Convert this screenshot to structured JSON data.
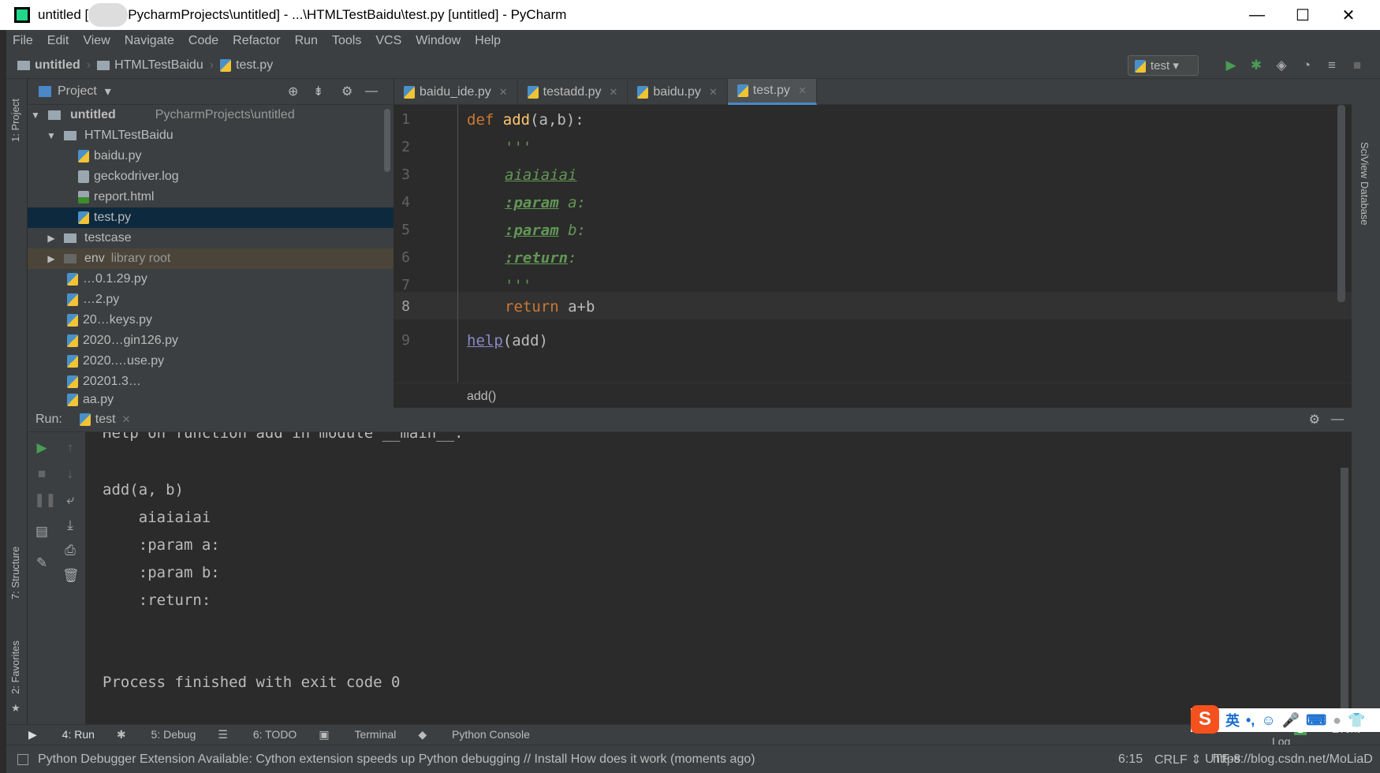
{
  "window": {
    "title_prefix": "untitled [",
    "title_rest": "PycharmProjects\\untitled] - ...\\HTMLTestBaidu\\test.py [untitled] - PyCharm",
    "minimize": "—",
    "maximize": "☐",
    "close": "✕"
  },
  "menu": [
    "File",
    "Edit",
    "View",
    "Navigate",
    "Code",
    "Refactor",
    "Run",
    "Tools",
    "VCS",
    "Window",
    "Help"
  ],
  "breadcrumb": [
    "untitled",
    "HTMLTestBaidu",
    "test.py"
  ],
  "run_config": "test",
  "side_labels": {
    "project": "1: Project",
    "structure": "7: Structure",
    "favorites": "2: Favorites",
    "sciview": "SciView",
    "database": "Database"
  },
  "project": {
    "title": "Project",
    "tree": [
      {
        "label": "untitled",
        "extra": "PycharmProjects\\untitled",
        "type": "folder",
        "open": true
      },
      {
        "label": "HTMLTestBaidu",
        "type": "folder",
        "open": true
      },
      {
        "label": "baidu.py",
        "type": "py"
      },
      {
        "label": "geckodriver.log",
        "type": "log"
      },
      {
        "label": "report.html",
        "type": "html"
      },
      {
        "label": "test.py",
        "type": "py",
        "selected": true
      },
      {
        "label": "testcase",
        "type": "folder",
        "open": false
      },
      {
        "label": "env",
        "extra": "library root",
        "type": "folder",
        "open": false
      },
      {
        "label": "…0.1.29.py",
        "type": "py"
      },
      {
        "label": "…2.py",
        "type": "py"
      },
      {
        "label": "20…keys.py",
        "type": "py"
      },
      {
        "label": "2020…gin126.py",
        "type": "py"
      },
      {
        "label": "2020.…use.py",
        "type": "py"
      },
      {
        "label": "20201.3…",
        "type": "py"
      },
      {
        "label": "aa.py",
        "type": "py"
      }
    ]
  },
  "tabs": [
    {
      "label": "baidu_ide.py"
    },
    {
      "label": "testadd.py"
    },
    {
      "label": "baidu.py"
    },
    {
      "label": "test.py",
      "active": true
    }
  ],
  "code": {
    "l1a": "def",
    "l1b": "add",
    "l1c": "(a,b):",
    "l2": "'''",
    "l3": "aiaiaiai",
    "l4a": ":param",
    "l4b": " a:",
    "l5a": ":param",
    "l5b": " b:",
    "l6a": ":return",
    "l6b": ":",
    "l7": "'''",
    "l8a": "return",
    "l8b": " a+b",
    "l9a": "help",
    "l9b": "(add)",
    "lines": [
      "1",
      "2",
      "3",
      "4",
      "5",
      "6",
      "7",
      "8",
      "9"
    ]
  },
  "editor_crumb": "add()",
  "run": {
    "label": "Run:",
    "tab": "test",
    "output": [
      "Help on function add in module __main__:",
      "",
      "add(a, b)",
      "    aiaiaiai",
      "    :param a:",
      "    :param b:",
      "    :return:",
      "",
      "",
      "Process finished with exit code 0"
    ]
  },
  "bottom_tabs": [
    "4: Run",
    "5: Debug",
    "6: TODO",
    "Terminal",
    "Python Console"
  ],
  "event_log": {
    "count": "1",
    "label": "Event Log"
  },
  "status": {
    "message": "Python Debugger Extension Available: Cython extension speeds up Python debugging // Install How does it work (moments ago)",
    "position": "6:15",
    "line_sep": "CRLF ⇕",
    "encoding": "UTF-8",
    "watermark": "https://blog.csdn.net/MoLiaD"
  },
  "ime": {
    "mode": "英"
  }
}
